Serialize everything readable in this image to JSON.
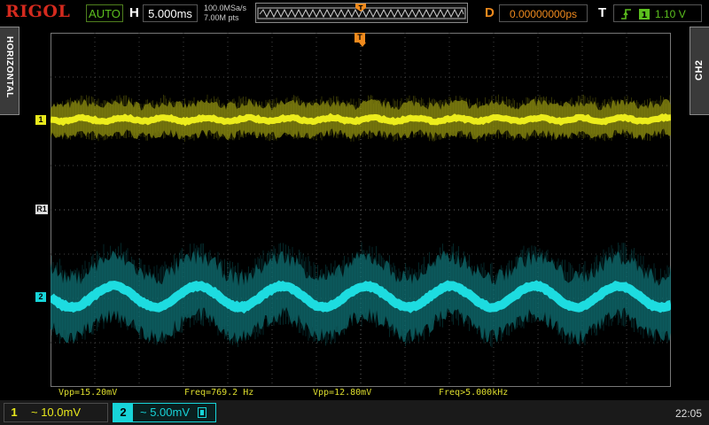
{
  "header": {
    "logo": "RIGOL",
    "run_status": "AUTO",
    "h_letter": "H",
    "timebase": "5.000ms",
    "sample_rate": "100.0MSa/s",
    "memory_depth": "7.00M pts",
    "d_letter": "D",
    "horizontal_offset": "0.00000000ps",
    "t_letter": "T",
    "trigger_level": "1.10 V"
  },
  "side_tabs": {
    "left": "HORIZONTAL",
    "right": "CH2"
  },
  "markers": {
    "ch1": "1",
    "ch2": "2",
    "ref": "R1",
    "trigger_top": "T"
  },
  "measurements": {
    "vpp1": "Vpp=15.20mV",
    "freq1": "Freq=769.2 Hz",
    "vpp2": "Vpp=12.80mV",
    "freq2": "Freq>5.000kHz"
  },
  "footer": {
    "ch1_num": "1",
    "ch1_value": "~ 10.0mV",
    "ch2_num": "2",
    "ch2_value": "~ 5.00mV",
    "clock": "22:05"
  },
  "colors": {
    "ch1": "#e8e81c",
    "ch2": "#17d4d8",
    "accent": "#f08a1d",
    "logo": "#d42a1e"
  }
}
